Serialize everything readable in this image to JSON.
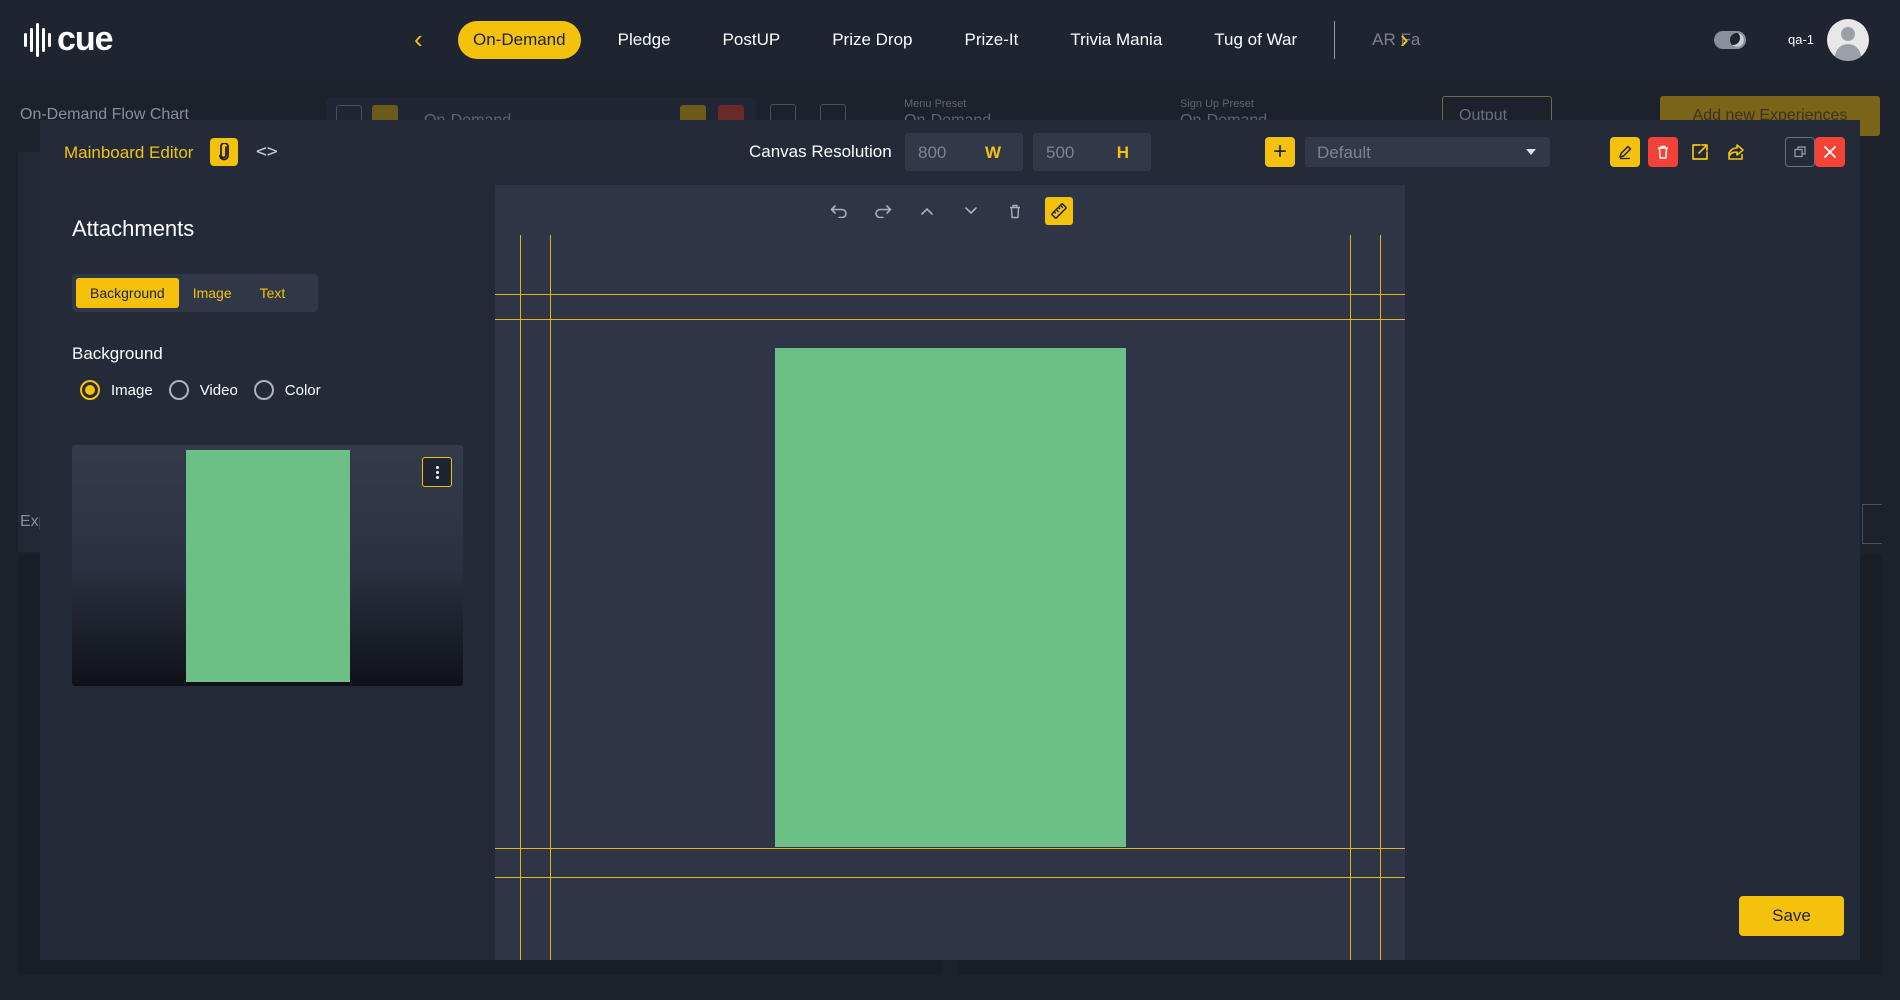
{
  "app": {
    "logo_text": "cue",
    "user_name": "qa-1"
  },
  "nav": {
    "tabs": [
      {
        "label": "On-Demand"
      },
      {
        "label": "Pledge"
      },
      {
        "label": "PostUP"
      },
      {
        "label": "Prize Drop"
      },
      {
        "label": "Prize-It"
      },
      {
        "label": "Trivia Mania"
      },
      {
        "label": "Tug of War"
      },
      {
        "label": "AR Fa"
      }
    ],
    "active_tab": "On-Demand"
  },
  "background_page": {
    "title": "On-Demand Flow Chart",
    "experience_select": "On-Demand",
    "menu_preset_label": "Menu Preset",
    "menu_preset_value": "On-Demand",
    "signup_preset_label": "Sign Up Preset",
    "signup_preset_value": "On-Demand",
    "output_label": "Output",
    "add_button_label": "Add new Experiences",
    "section_label": "Exp"
  },
  "modal": {
    "title": "Mainboard Editor",
    "canvas_resolution_label": "Canvas Resolution",
    "width_value": "800",
    "width_unit": "W",
    "height_value": "500",
    "height_unit": "H",
    "preset_value": "Default",
    "save_label": "Save"
  },
  "attachments": {
    "title": "Attachments",
    "tabs": [
      "Background",
      "Image",
      "Text"
    ],
    "active_tab": "Background",
    "section_title": "Background",
    "options": [
      "Image",
      "Video",
      "Color"
    ],
    "selected_option": "Image"
  },
  "colors": {
    "accent": "#f4c20d",
    "danger": "#f44336",
    "background_fill": "#6cc085",
    "modal_bg": "#242b38",
    "canvas_bg": "#2d3547"
  }
}
